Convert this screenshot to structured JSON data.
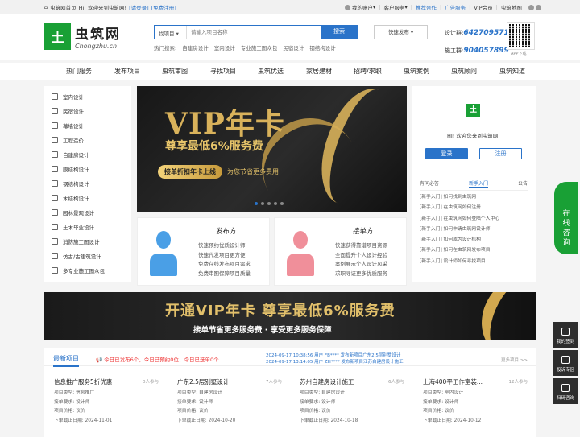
{
  "topbar": {
    "home": "虫筑网首页",
    "welcome": "Hi! 欢迎来到虫筑网!",
    "login": "[请登录]",
    "register": "[免费注册]",
    "my_account": "我的账户",
    "client": "客户服务",
    "recommend": "推荐合作",
    "ad": "广告服务",
    "vip": "VIP会员",
    "map": "虫筑地图"
  },
  "logo": {
    "mark": "土",
    "cn": "虫筑网",
    "en": "Chongzhu.cn"
  },
  "search": {
    "select": "找项目",
    "placeholder": "请输入项目名称",
    "button": "搜索",
    "quick": "快速发布"
  },
  "hot_search": {
    "label": "热门搜索:",
    "items": [
      "自建房设计",
      "室内设计",
      "专业施工图众包",
      "民宿设计",
      "钢结构设计"
    ]
  },
  "phones": {
    "design_label": "设计群:",
    "design_num": "642709571",
    "build_label": "施工群:",
    "build_num": "904057899",
    "qr_label": "APP下载"
  },
  "nav": [
    "热门服务",
    "发布项目",
    "虫筑审图",
    "寻找项目",
    "虫筑优选",
    "家居建材",
    "招聘/求职",
    "虫筑案例",
    "虫筑顾问",
    "虫筑知道"
  ],
  "sidebar": [
    "室内设计",
    "民宿设计",
    "幕墙设计",
    "工程造价",
    "自建房设计",
    "膜结构设计",
    "钢结构设计",
    "木结构设计",
    "园林景观设计",
    "土木毕业设计",
    "消防施工图设计",
    "仿古/古建筑设计",
    "多专业施工图众包"
  ],
  "banner": {
    "title": "VIP年卡",
    "subtitle": "尊享最低6%服务费",
    "cta": "接单折扣年卡上线",
    "cta2": "为您节省更多费用"
  },
  "card_pub": {
    "title": "发布方",
    "lines": [
      "快速预约优质设计师",
      "快速代发项目更方便",
      "免费在线发布项目需求",
      "免费审图保障项目质量"
    ]
  },
  "card_take": {
    "title": "接单方",
    "lines": [
      "快速获得靠谱项目资源",
      "全面提升个人设计经验",
      "案例展示个人设计风采",
      "求职寻证更多优质服务"
    ]
  },
  "login": {
    "logo": "土",
    "hi": "HI! 欢迎您来到虫筑网!",
    "login_btn": "登录",
    "reg_btn": "注册",
    "tabs": [
      "有问必答",
      "新手入门",
      "公告"
    ],
    "list": [
      "[新手入门] 如何找到虫筑网",
      "[新手入门] 在虫筑网如何注册",
      "[新手入门] 在虫筑网如何登陆个人中心",
      "[新手入门] 如何申请虫筑网设计师",
      "[新手入门] 如何成为设计机构",
      "[新手入门] 如何在虫筑网发布项目",
      "[新手入门] 设计师如何寻找项目"
    ]
  },
  "wide_banner": {
    "line1": "开通VIP年卡 尊享最低6%服务费",
    "line2": "接单节省更多服务费 · 享受更多服务保障"
  },
  "latest": {
    "title": "最新项目",
    "stat": "今日已发布6个，今日已预约0位，今日已选单0个",
    "ticker1": "2024-09-17 10:38:56 用户 FB**** 发布新项目广东2.5层别墅设计",
    "ticker2": "2024-09-17 13:14:05 用户 ZH**** 发布新项目江苏自建房设计施工",
    "more": "更多项目 >>",
    "projects": [
      {
        "title": "信息推广服务5折优惠",
        "count": "0人参与",
        "type": "项目类型: 信息推广",
        "req": "接单要求: 设计师",
        "price": "项目价格: 议价",
        "date": "下单截止日期: 2024-11-01"
      },
      {
        "title": "广东2.5层别墅设计",
        "count": "7人参与",
        "type": "项目类型: 自建房设计",
        "req": "接单要求: 设计师",
        "price": "项目价格: 议价",
        "date": "下单截止日期: 2024-10-20"
      },
      {
        "title": "苏州自建房设计施工",
        "count": "6人参与",
        "type": "项目类型: 自建房设计",
        "req": "接单要求: 设计师",
        "price": "项目价格: 议价",
        "date": "下单截止日期: 2024-10-18"
      },
      {
        "title": "上海400平工作室装...",
        "count": "12人参与",
        "type": "项目类型: 室内设计",
        "req": "接单要求: 设计师",
        "price": "项目价格: 议价",
        "date": "下单截止日期: 2024-10-12"
      }
    ]
  },
  "float": {
    "consult": "在线咨询",
    "sign": "我的签到",
    "report": "投诉专区",
    "scan": "扫码咨询"
  },
  "colors": {
    "brand_green": "#19a035",
    "brand_blue": "#2a73c9"
  }
}
